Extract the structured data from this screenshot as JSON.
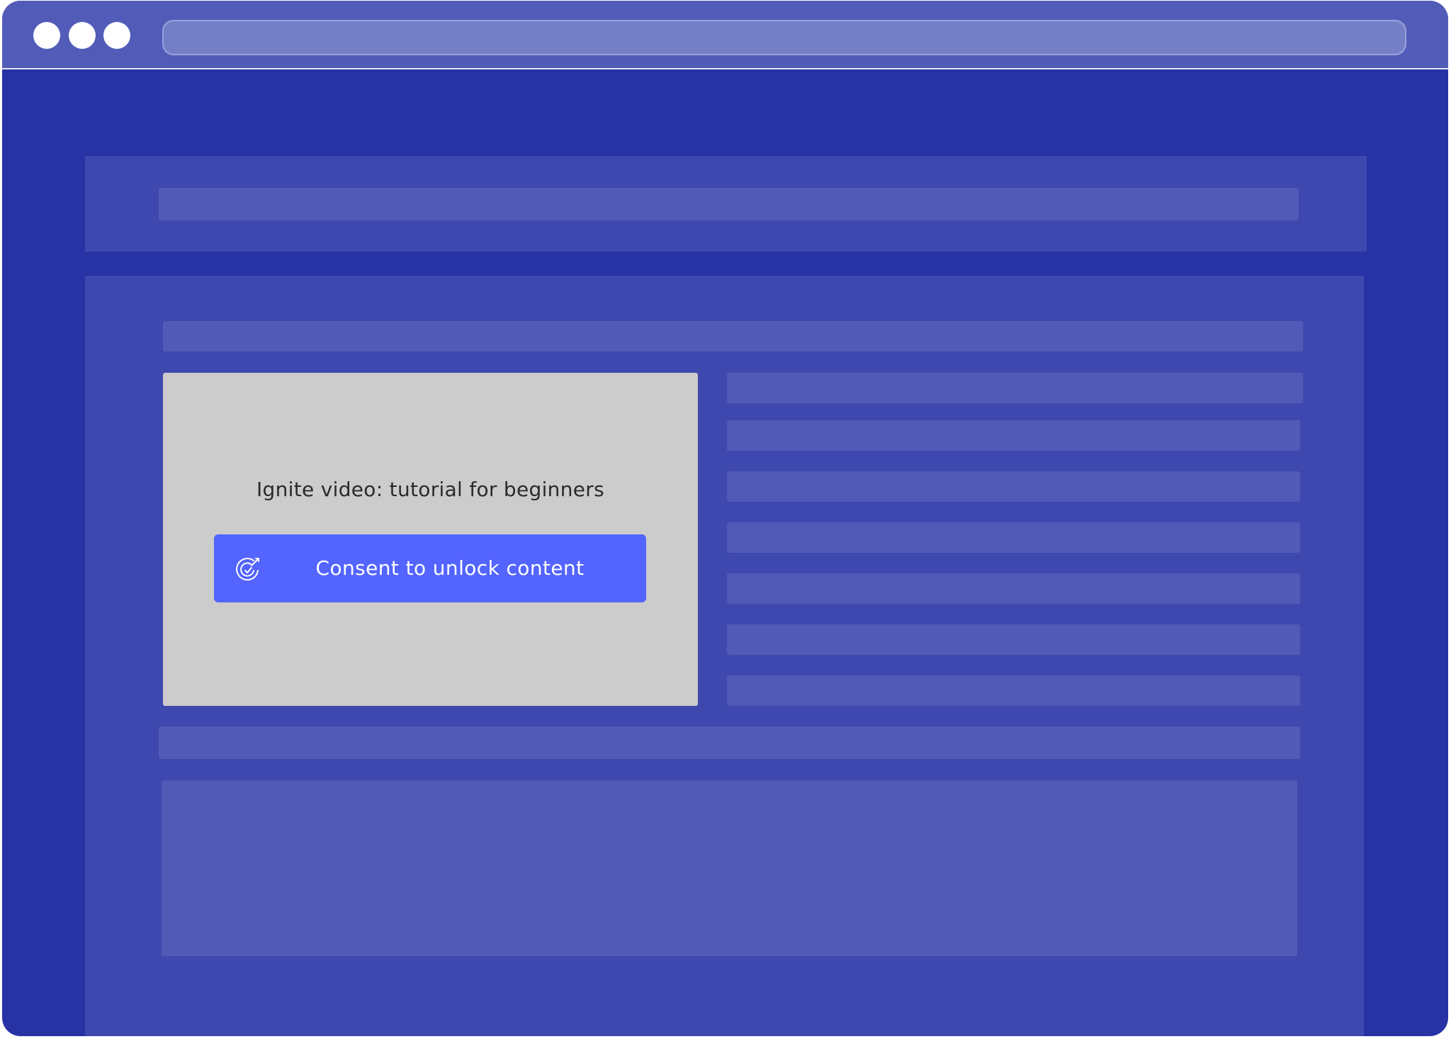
{
  "browser": {
    "window_controls": [
      "dot",
      "dot",
      "dot"
    ],
    "address_bar_value": ""
  },
  "embed": {
    "title": "Ignite video: tutorial for beginners",
    "consent_button_label": "Consent to unlock content",
    "consent_icon": "target-check-icon"
  },
  "colors": {
    "page_background": "#2733a5",
    "title_bar": "#525cb8",
    "panel": "#3e48ae",
    "placeholder_bar": "#515ab6",
    "video_placeholder": "#cccccc",
    "consent_button": "#5364ff"
  }
}
